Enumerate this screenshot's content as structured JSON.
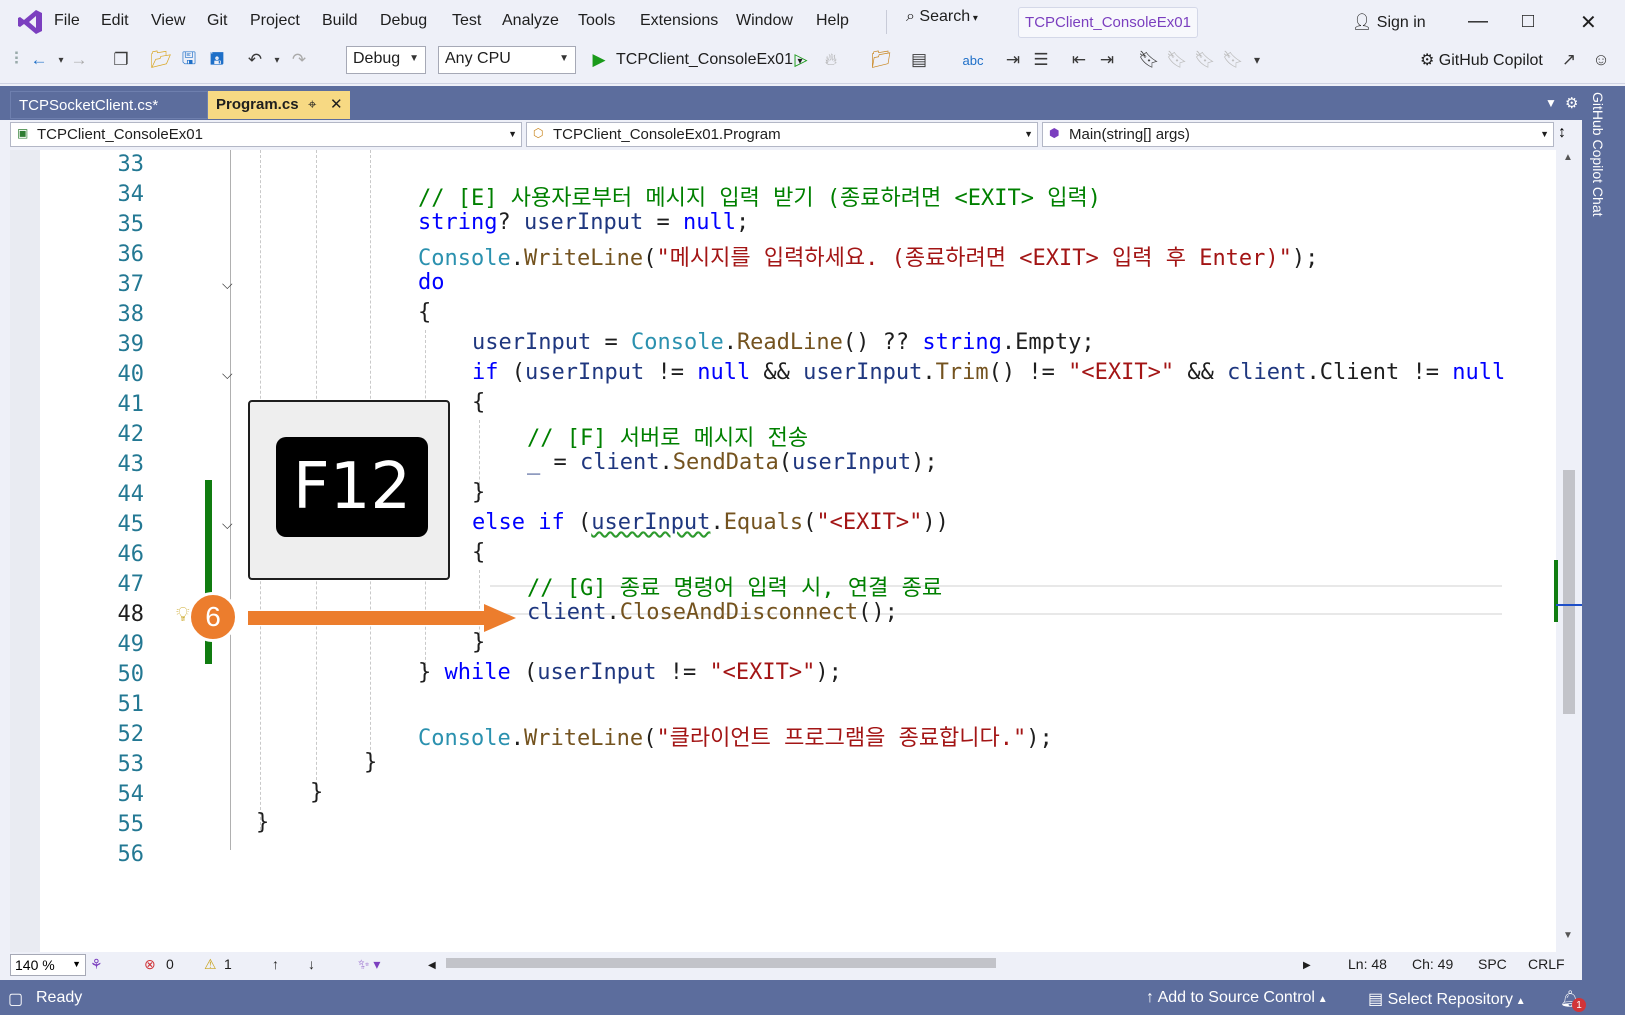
{
  "menu": [
    "File",
    "Edit",
    "View",
    "Git",
    "Project",
    "Build",
    "Debug",
    "Test",
    "Analyze",
    "Tools",
    "Extensions",
    "Window",
    "Help"
  ],
  "search_label": "Search",
  "project_name": "TCPClient_ConsoleEx01",
  "signin_label": "Sign in",
  "toolbar": {
    "config": "Debug",
    "platform": "Any CPU",
    "run_target": "TCPClient_ConsoleEx01",
    "copilot_label": "GitHub Copilot"
  },
  "tabs": [
    {
      "label": "TCPSocketClient.cs*"
    },
    {
      "label": "Program.cs"
    }
  ],
  "nav": {
    "project": "TCPClient_ConsoleEx01",
    "class": "TCPClient_ConsoleEx01.Program",
    "member": "Main(string[] args)"
  },
  "line_numbers": [
    "33",
    "34",
    "35",
    "36",
    "37",
    "38",
    "39",
    "40",
    "41",
    "42",
    "43",
    "44",
    "45",
    "46",
    "47",
    "48",
    "49",
    "50",
    "51",
    "52",
    "53",
    "54",
    "55",
    "56"
  ],
  "code": {
    "l34": "// [E] 사용자로부터 메시지 입력 받기 (종료하려면 <EXIT> 입력)",
    "l35_kw": "string",
    "l35_rest": "? ",
    "l35_var": "userInput",
    "l35_eq": " = ",
    "l35_null": "null",
    "l35_end": ";",
    "l36_ty": "Console",
    "l36_dot": ".",
    "l36_m": "WriteLine",
    "l36_p": "(",
    "l36_s": "\"메시지를 입력하세요. (종료하려면 <EXIT> 입력 후 Enter)\"",
    "l36_e": ");",
    "l37": "do",
    "l38": "{",
    "l39_v": "userInput",
    "l39_a": " = ",
    "l39_ty": "Console",
    "l39_dot": ".",
    "l39_m": "ReadLine",
    "l39_b": "() ?? ",
    "l39_kw": "string",
    "l39_e": ".Empty;",
    "l40_kw": "if",
    "l40_a": " (",
    "l40_v1": "userInput",
    "l40_b": " != ",
    "l40_null": "null",
    "l40_c": " && ",
    "l40_v2": "userInput",
    "l40_dot": ".",
    "l40_m": "Trim",
    "l40_d": "() != ",
    "l40_s": "\"<EXIT>\"",
    "l40_e": " && ",
    "l40_v3": "client",
    "l40_f": ".Client != ",
    "l40_null2": "null",
    "l41": "{",
    "l42": "// [F] 서버로 메시지 전송",
    "l43_v": "_",
    "l43_a": " = ",
    "l43_v2": "client",
    "l43_dot": ".",
    "l43_m": "SendData",
    "l43_p": "(",
    "l43_v3": "userInput",
    "l43_e": ");",
    "l44": "}",
    "l45_kw": "else if",
    "l45_a": " (",
    "l45_v": "userInput",
    "l45_dot": ".",
    "l45_m": "Equals",
    "l45_p": "(",
    "l45_s": "\"<EXIT>\"",
    "l45_e": "))",
    "l46": "{",
    "l47": "// [G] 종료 명령어 입력 시, 연결 종료",
    "l48_v": "client",
    "l48_dot": ".",
    "l48_m": "CloseAndDisconnect",
    "l48_e": "();",
    "l49": "}",
    "l50_a": "} ",
    "l50_kw": "while",
    "l50_b": " (",
    "l50_v": "userInput",
    "l50_c": " != ",
    "l50_s": "\"<EXIT>\"",
    "l50_e": ");",
    "l52_ty": "Console",
    "l52_dot": ".",
    "l52_m": "WriteLine",
    "l52_p": "(",
    "l52_s": "\"클라이언트 프로그램을 종료합니다.\"",
    "l52_e": ");",
    "l53": "}",
    "l54": "}",
    "l55": "}"
  },
  "overlay": {
    "key_label": "F12",
    "step_number": "6"
  },
  "editor_status": {
    "zoom": "140 %",
    "errors": "0",
    "warnings": "1",
    "ln": "Ln: 48",
    "ch": "Ch: 49",
    "spc": "SPC",
    "eol": "CRLF"
  },
  "side_rail_label": "GitHub Copilot Chat",
  "statusbar": {
    "ready": "Ready",
    "add_source": "Add to Source Control",
    "select_repo": "Select Repository",
    "notifications": "1"
  },
  "colors": {
    "accent_purple": "#7b3fbf",
    "tab_active": "#f7d983",
    "chrome_blue": "#5c6d9d",
    "overlay_orange": "#ec7d2d",
    "change_green": "#107c10"
  }
}
